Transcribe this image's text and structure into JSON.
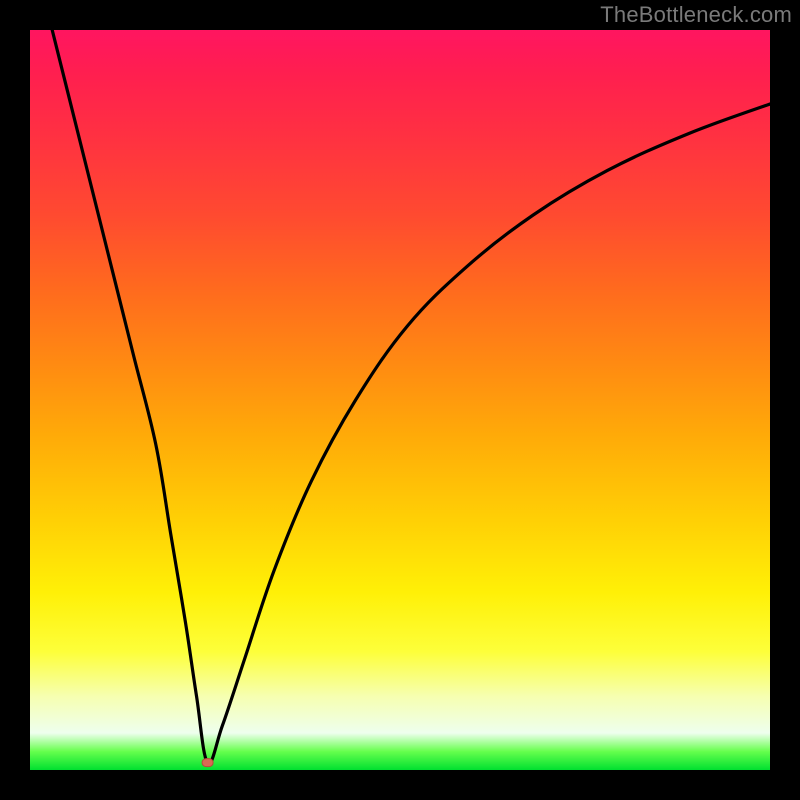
{
  "watermark": "TheBottleneck.com",
  "chart_data": {
    "type": "line",
    "title": "",
    "xlabel": "",
    "ylabel": "",
    "xlim": [
      0,
      100
    ],
    "ylim": [
      0,
      100
    ],
    "grid": false,
    "legend": false,
    "series": [
      {
        "name": "bottleneck-curve",
        "style": "line",
        "color": "#000000",
        "x": [
          3,
          5,
          8,
          11,
          14,
          17,
          19,
          21,
          22.5,
          24,
          26,
          29,
          33,
          38,
          44,
          51,
          59,
          68,
          78,
          89,
          100
        ],
        "values": [
          100,
          92,
          80,
          68,
          56,
          44,
          32,
          20,
          10,
          1,
          6,
          15,
          27,
          39,
          50,
          60,
          68,
          75,
          81,
          86,
          90
        ]
      }
    ],
    "marker": {
      "x": 24,
      "y": 1,
      "color": "#d86a54"
    },
    "background_gradient": {
      "type": "vertical",
      "stops": [
        {
          "pos": 0,
          "color": "#ff1560"
        },
        {
          "pos": 14,
          "color": "#ff3042"
        },
        {
          "pos": 35,
          "color": "#ff6a1e"
        },
        {
          "pos": 55,
          "color": "#ffab08"
        },
        {
          "pos": 76,
          "color": "#fff007"
        },
        {
          "pos": 90,
          "color": "#f6ffb0"
        },
        {
          "pos": 97,
          "color": "#66ff4d"
        },
        {
          "pos": 100,
          "color": "#00e030"
        }
      ]
    }
  }
}
